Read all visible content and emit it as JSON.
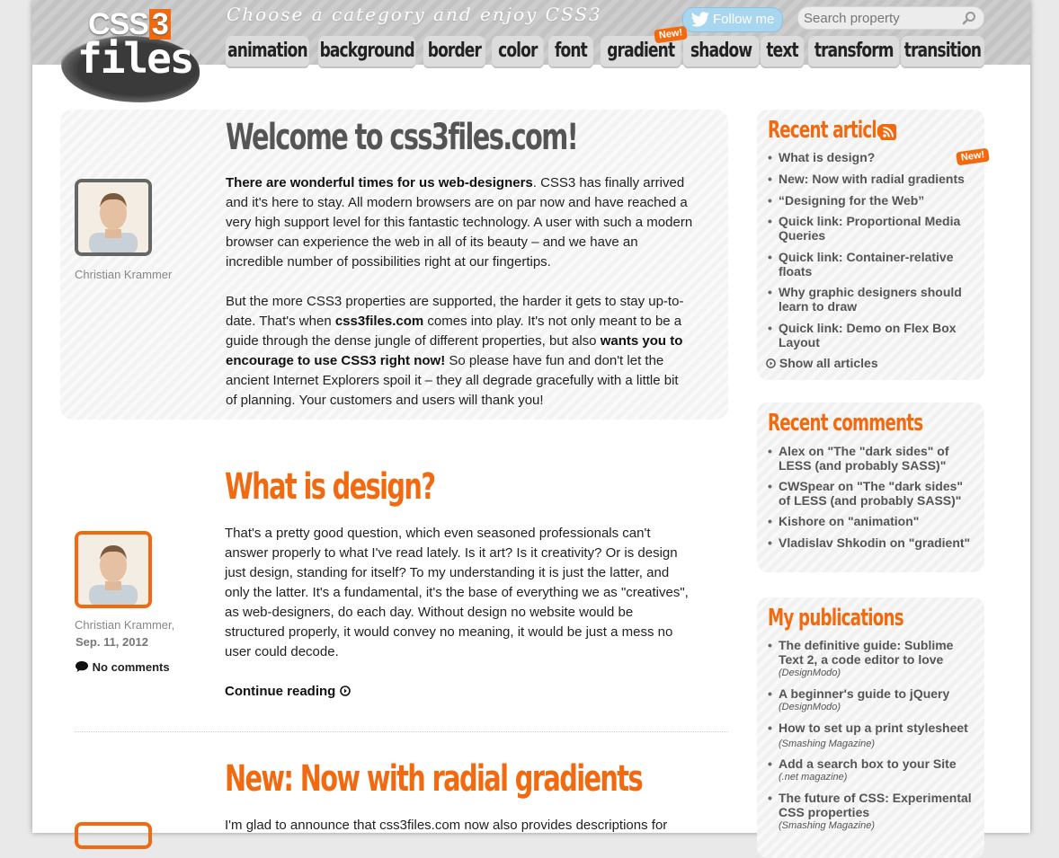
{
  "header": {
    "logo_top": "CSS",
    "logo_three": "3",
    "logo_bottom": "files",
    "tagline": "Choose a category and enjoy CSS3",
    "follow_label": "Follow me",
    "search_placeholder": "Search property",
    "new_badge": "New!"
  },
  "nav": {
    "tabs": [
      "animation",
      "background",
      "border",
      "color",
      "font",
      "gradient",
      "shadow",
      "text",
      "transform",
      "transition"
    ]
  },
  "welcome": {
    "title": "Welcome to css3files.com!",
    "author": "Christian Krammer",
    "p1_bold": "There are wonderful times for us web-designers",
    "p1_rest": ". CSS3 has finally arrived and it's here to stay. All modern browsers are on par now and have reached a very high support level for this fantastic technology. A user with such a modern browser can experience the web in all of its beauty – and we have an incredible number of possibilities right at our fingertips.",
    "p2_a": "But the more CSS3 properties are supported, the harder it gets to stay up-to-date. That's when ",
    "p2_b": "css3files.com",
    "p2_c": " comes into play. It's not only meant to be a guide through the dense jungle of different properties, but also ",
    "p2_d": "wants you to encourage to use CSS3 right now!",
    "p2_e": " So please have fun and don't let the ancient Internet Explorers spoil it – they all degrade gracefully with a little bit of planning. Your customers and users will thank you!"
  },
  "posts": [
    {
      "title": "What is design?",
      "author": "Christian Krammer,",
      "date": "Sep. 11, 2012",
      "comments": "No comments",
      "body": "That's a pretty good question, which even seasoned professionals can't answer properly to what I've read lately. Is it art? Is it creativity? Or is design just design, standing for itself? To my understanding it is just the latter, and only the latter. It's a fundamental, it's the base of everything we as \"creatives\", as web-designers, do each day. Without design no website would be structured properly, it would convey no meaning, it would be just a mess no user could decode.",
      "continue": "Continue reading"
    },
    {
      "title": "New: Now with radial gradients",
      "body": "I'm glad to announce that css3files.com now also provides descriptions for"
    }
  ],
  "sidebar": {
    "recent_articles": {
      "title": "Recent articles",
      "items": [
        "What is design?",
        "New: Now with radial gradients",
        "“Designing for the Web”",
        "Quick link: Proportional Media Queries",
        "Quick link: Container-relative floats",
        "Why graphic designers should learn to draw",
        "Quick link: Demo on Flex Box Layout"
      ],
      "show_all": "Show all articles"
    },
    "recent_comments": {
      "title": "Recent comments",
      "items": [
        "Alex on \"The \"dark sides\" of LESS (and probably SASS)\"",
        "CWSpear on \"The \"dark sides\" of LESS (and probably SASS)\"",
        "Kishore on \"animation\"",
        "Vladislav Shkodin on \"gradient\""
      ]
    },
    "publications": {
      "title": "My publications",
      "items": [
        {
          "title": "The definitive guide: Sublime Text 2, a code editor to love",
          "source": "(DesignModo)"
        },
        {
          "title": "A beginner's guide to jQuery",
          "source": "(DesignModo)"
        },
        {
          "title": "How to set up a print stylesheet",
          "source": "(Smashing Magazine)"
        },
        {
          "title": "Add a search box to your Site",
          "source": "(.net magazine)"
        },
        {
          "title": "The future of CSS: Experimental CSS properties",
          "source": "(Smashing Magazine)"
        }
      ]
    }
  },
  "colors": {
    "accent": "#f26a10",
    "twitter": "#a8d6ef",
    "header_band": "#c9c9c9"
  }
}
